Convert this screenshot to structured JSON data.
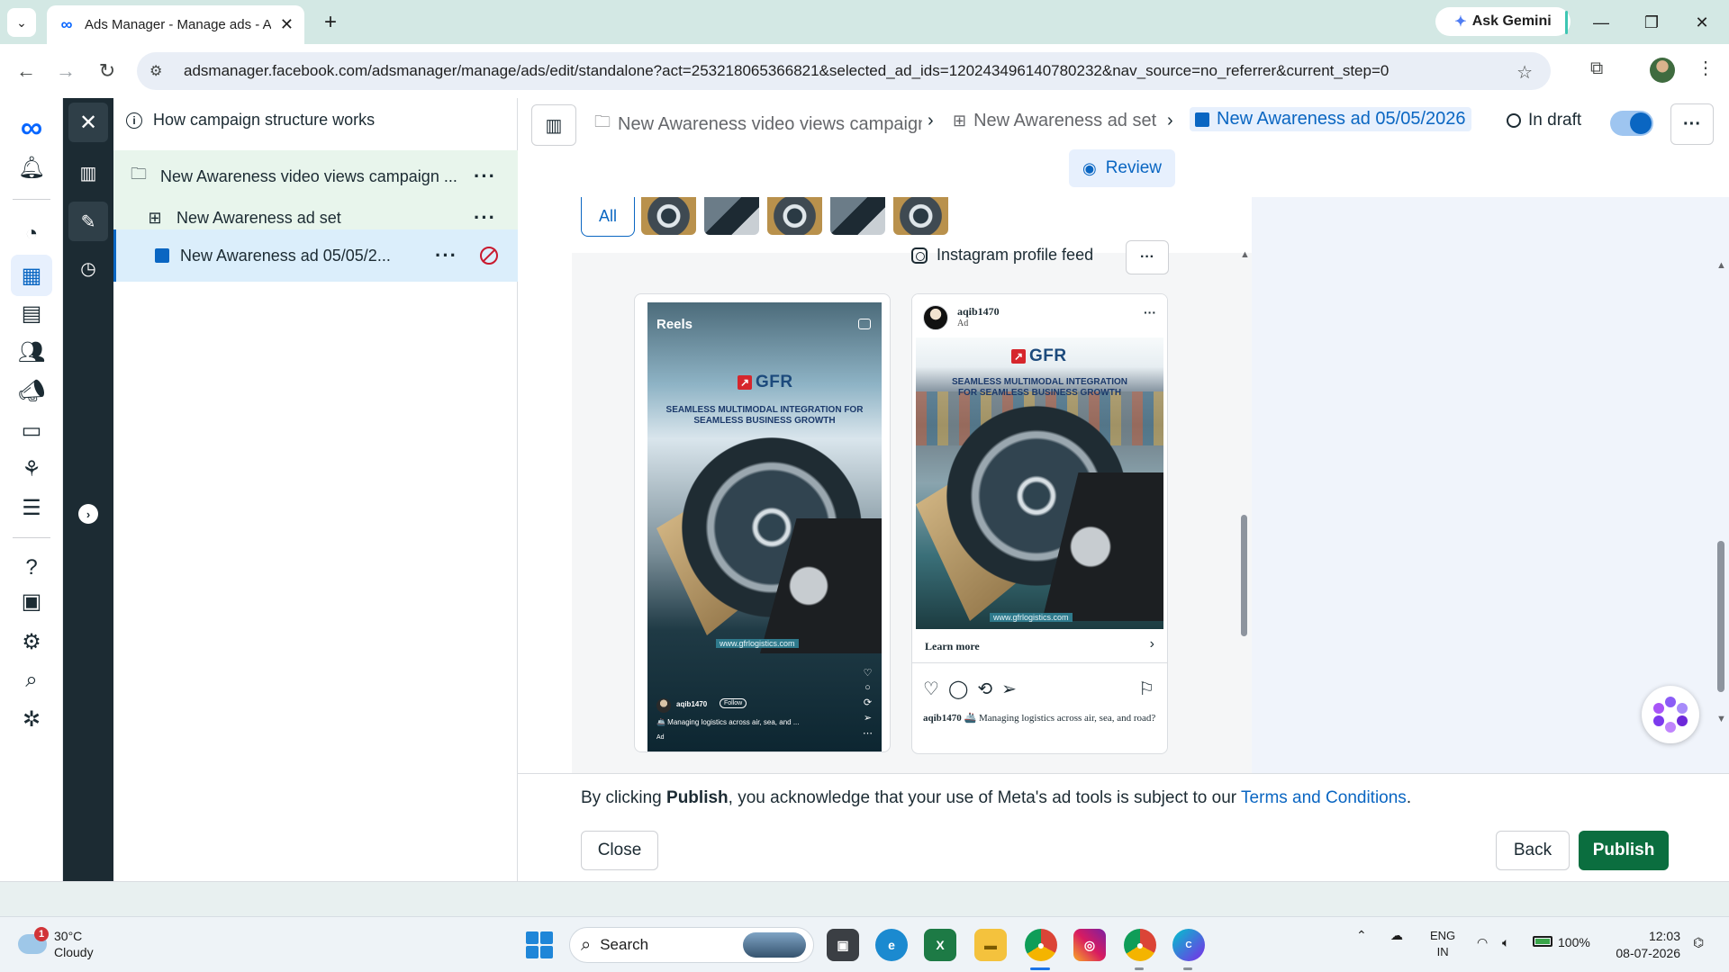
{
  "browser": {
    "tab_title": "Ads Manager - Manage ads - A",
    "gemini_label": "Ask Gemini",
    "url": "adsmanager.facebook.com/adsmanager/manage/ads/edit/standalone?act=253218065366821&selected_ad_ids=120243496140780232&nav_source=no_referrer&current_step=0"
  },
  "tree": {
    "help_link": "How campaign structure works",
    "campaign": "New Awareness video views campaign ...",
    "ad_set": "New Awareness ad set",
    "ad": "New Awareness ad 05/05/2..."
  },
  "header": {
    "breadcrumb_campaign": "New Awareness video views campaign (",
    "breadcrumb_adset": "New Awareness ad set",
    "breadcrumb_ad": "New Awareness ad 05/05/2026",
    "status": "In draft",
    "review_label": "Review"
  },
  "preview": {
    "filter_all": "All",
    "placement": "Instagram profile feed",
    "reels": {
      "title": "Reels",
      "brand": "GFR",
      "headline": "SEAMLESS MULTIMODAL INTEGRATION FOR SEAMLESS BUSINESS GROWTH",
      "website": "www.gfrlogistics.com",
      "username": "aqib1470",
      "follow": "Follow",
      "caption": "🚢 Managing logistics across air, sea, and ...",
      "ad_label": "Ad"
    },
    "feed": {
      "username": "aqib1470",
      "ad_label": "Ad",
      "brand": "GFR",
      "headline": "SEAMLESS MULTIMODAL INTEGRATION FOR SEAMLESS BUSINESS GROWTH",
      "website": "www.gfrlogistics.com",
      "cta": "Learn more",
      "caption_user": "aqib1470",
      "caption_text": "🚢 Managing logistics across air, sea, and road?"
    }
  },
  "footer": {
    "legal_prefix": "By clicking ",
    "legal_bold": "Publish",
    "legal_middle": ", you acknowledge that your use of Meta's ad tools is subject to our ",
    "legal_link": "Terms and Conditions",
    "legal_suffix": ".",
    "close_label": "Close",
    "back_label": "Back",
    "publish_label": "Publish"
  },
  "taskbar": {
    "weather_temp": "30°C",
    "weather_desc": "Cloudy",
    "weather_badge": "1",
    "search_label": "Search",
    "lang_top": "ENG",
    "lang_bottom": "IN",
    "battery": "100%",
    "time": "12:03",
    "date": "08-07-2026"
  },
  "colors": {
    "publish": "#0b6e3f",
    "accent": "#0a66c2",
    "tree_highlight": "#e8f5ec"
  }
}
